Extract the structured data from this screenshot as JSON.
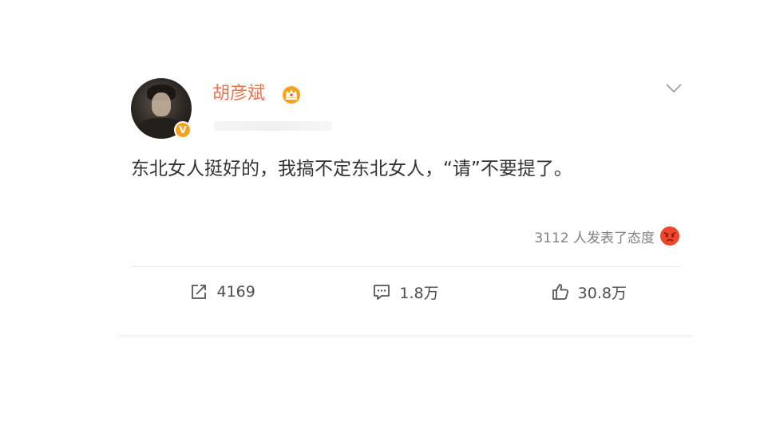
{
  "post": {
    "author": {
      "name": "胡彦斌",
      "verified": true,
      "verified_symbol": "V",
      "accent_color": "#eb7350",
      "badge_color": "#f7a21b"
    },
    "text": "东北女人挺好的，我搞不定东北女人，“请”不要提了。",
    "reaction_summary": "3112 人发表了态度",
    "actions": {
      "repost_count": "4169",
      "comment_count": "1.8万",
      "like_count": "30.8万"
    }
  },
  "icons": {
    "crown": "crown-icon",
    "more": "chevron-down-icon",
    "reaction": "angry-face-icon",
    "repost": "repost-icon",
    "comment": "comment-icon",
    "like": "thumbs-up-icon"
  }
}
